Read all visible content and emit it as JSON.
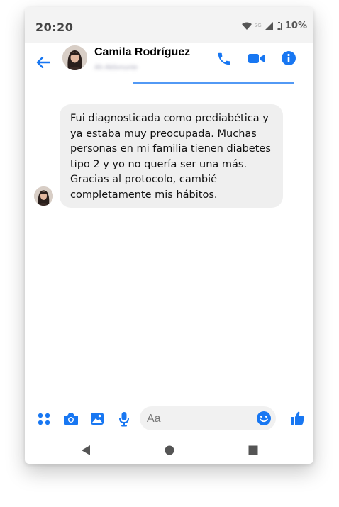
{
  "status_bar": {
    "time": "20:20",
    "network": "3G",
    "battery": "10%"
  },
  "header": {
    "contact_name": "Camila Rodríguez",
    "contact_status": "Ah Aktivnunte"
  },
  "conversation": {
    "messages": [
      {
        "text": "Fui diagnosticada como prediabética y ya estaba muy preocupada. Muchas personas en mi familia tienen diabetes tipo 2 y yo no quería ser una más. Gracias al protocolo, cambié completamente mis hábitos."
      }
    ]
  },
  "composer": {
    "placeholder": "Aa"
  },
  "colors": {
    "accent": "#1877f2",
    "bubble": "#efefef"
  },
  "icons": [
    "back-arrow-icon",
    "phone-icon",
    "video-icon",
    "info-icon",
    "apps-icon",
    "camera-icon",
    "image-icon",
    "mic-icon",
    "emoji-icon",
    "like-icon",
    "nav-back-icon",
    "nav-home-icon",
    "nav-recents-icon"
  ]
}
